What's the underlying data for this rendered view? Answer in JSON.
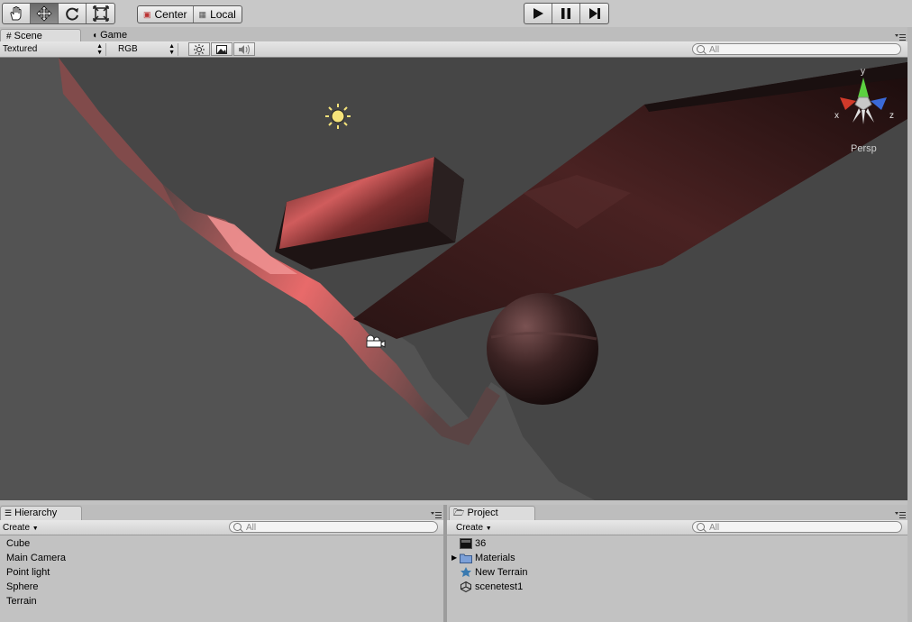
{
  "toolbar": {
    "tools": [
      "hand-tool-icon",
      "move-tool-icon",
      "rotate-tool-icon",
      "scale-tool-icon"
    ],
    "pivot_label": "Center",
    "space_label": "Local"
  },
  "scene": {
    "tabs": [
      {
        "label": "Scene"
      },
      {
        "label": "Game"
      }
    ],
    "render_mode": "Textured",
    "color_mode": "RGB",
    "search_placeholder": "All",
    "gizmo_label": "Persp",
    "gizmo_axes": {
      "y": "y",
      "x": "x",
      "z": "z"
    }
  },
  "hierarchy": {
    "title": "Hierarchy",
    "create_label": "Create",
    "search_placeholder": "All",
    "items": [
      {
        "label": "Cube"
      },
      {
        "label": "Main Camera"
      },
      {
        "label": "Point light"
      },
      {
        "label": "Sphere"
      },
      {
        "label": "Terrain"
      }
    ]
  },
  "project": {
    "title": "Project",
    "create_label": "Create",
    "search_placeholder": "All",
    "items": [
      {
        "label": "36",
        "icon": "texture-icon"
      },
      {
        "label": "Materials",
        "icon": "folder-icon"
      },
      {
        "label": "New Terrain",
        "icon": "terrain-icon"
      },
      {
        "label": "scenetest1",
        "icon": "unity-scene-icon"
      }
    ]
  },
  "colors": {
    "viewport_bg": "#464646",
    "terrain_highlight": "#e06060",
    "panel_bg": "#c2c2c2"
  }
}
